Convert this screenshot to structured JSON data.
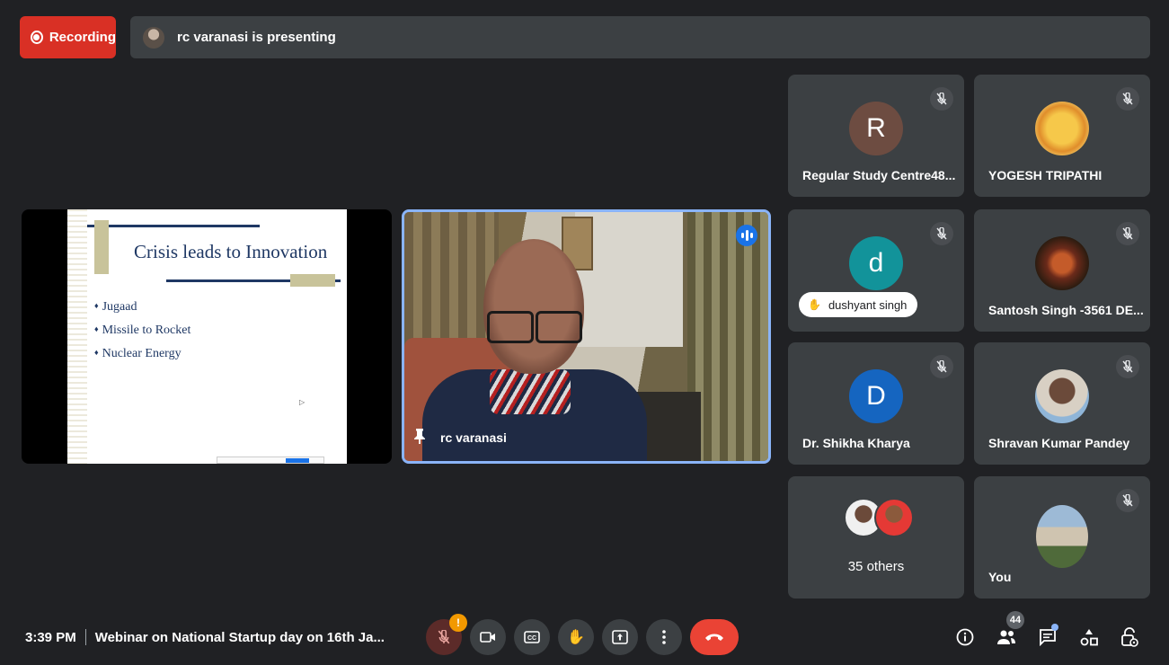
{
  "recording": {
    "label": "Recording"
  },
  "presenting": {
    "text": "rc varanasi is presenting"
  },
  "slide": {
    "title": "Crisis leads to Innovation",
    "bullets": [
      "Jugaad",
      "Missile to Rocket",
      "Nuclear Energy"
    ]
  },
  "speaker": {
    "name": "rc varanasi"
  },
  "participants": [
    {
      "name": "Regular Study Centre48...",
      "initial": "R",
      "avatar_color": "#6d4c41",
      "muted": true
    },
    {
      "name": "YOGESH TRIPATHI",
      "initial": "",
      "avatar_color": "#f6c84a",
      "muted": true
    },
    {
      "name": "dushyant singh",
      "initial": "d",
      "avatar_color": "#12939a",
      "muted": true,
      "hand_raised": true
    },
    {
      "name": "Santosh Singh -3561 DE...",
      "initial": "",
      "avatar_color": "#6b2a1a",
      "muted": true
    },
    {
      "name": "Dr. Shikha Kharya",
      "initial": "D",
      "avatar_color": "#1565c0",
      "muted": true
    },
    {
      "name": "Shravan Kumar Pandey",
      "initial": "",
      "avatar_color": "#8fb5d8",
      "muted": true
    },
    {
      "name": "35 others",
      "initial": "",
      "muted": false
    },
    {
      "name": "You",
      "initial": "",
      "avatar_color": "#9dbad6",
      "muted": true
    }
  ],
  "bottom": {
    "time": "3:39 PM",
    "meeting_title": "Webinar on National Startup day on 16th Ja...",
    "mic_warning": "!",
    "people_count": "44"
  },
  "colors": {
    "accent": "#8ab4f8",
    "recording": "#d93025",
    "end_call": "#ea4335",
    "tile": "#3c4043",
    "background": "#202124"
  },
  "icons": [
    "record-icon",
    "mic-off-icon",
    "camera-icon",
    "captions-icon",
    "raise-hand-icon",
    "present-icon",
    "more-options-icon",
    "end-call-icon",
    "info-icon",
    "people-icon",
    "chat-icon",
    "activities-icon",
    "host-controls-icon",
    "pin-icon",
    "speaking-icon"
  ]
}
